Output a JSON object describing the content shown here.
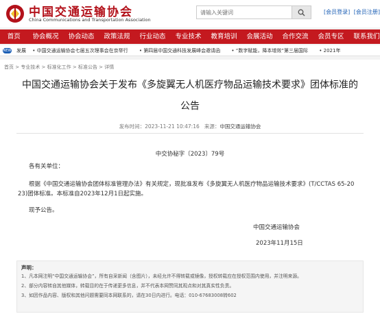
{
  "header": {
    "logo_cn": "中国交通运输协会",
    "logo_en": "China Communications and Transportation Association",
    "search_placeholder": "请输入关键词",
    "login_label": "[会员登录]",
    "register_label": "[会员注册]"
  },
  "nav": {
    "items": [
      "首页",
      "协会概况",
      "协会动态",
      "政策法规",
      "行业动态",
      "专业技术",
      "教育培训",
      "会展活动",
      "合作交流",
      "会员专区",
      "联系我们"
    ]
  },
  "ticker": {
    "badge": "NEW",
    "items": [
      "发展",
      "中国交通运输协会七届五次理事会在京举行",
      "第四届中国交通科技发展峰会邀请函",
      "“数字赋能，降本增效”第三届国际",
      "2021年"
    ]
  },
  "breadcrumb": "首页 > 专业技术 > 标准化工作 > 标准公告 > 详情",
  "article": {
    "title_line1": "中国交通运输协会关于发布《多旋翼无人机医疗物品运输技术要求》团体标准的",
    "title_line2": "公告",
    "publish_label": "发布时间：2023-11-21 10:47:16",
    "source_label": "来源：",
    "source_value": "中国交通运输协会",
    "doc_number": "中交协秘字〔2023〕79号",
    "salutation": "各有关单位：",
    "body_line1": "根据《中国交通运输协会团体标准管理办法》有关规定，现批准发布《多旋翼无人机医疗物品运输技术要求》(T/CCTAS 65-20",
    "body_line2": "23)团体标准。本标准自2023年12月1日起实施。",
    "closing": "现予公告。",
    "signature": "中国交通运输协会",
    "date": "2023年11月15日"
  },
  "notice": {
    "title": "声明：",
    "items": [
      "1、凡本网注明“中国交通运输协会”，所有自采新闻（含图片），未经允许不得转载或镜像，授权转载应在授权范围内使用，并注明来源。",
      "2、部分内容转自其他媒体，转载目的在于传递更多信息，并不代表本网赞同其观点和对其真实性负责。",
      "3、如因作品内容、版权和其他问题需要同本网联系的，请在30日内进行。电话：010-67683008转602"
    ]
  }
}
